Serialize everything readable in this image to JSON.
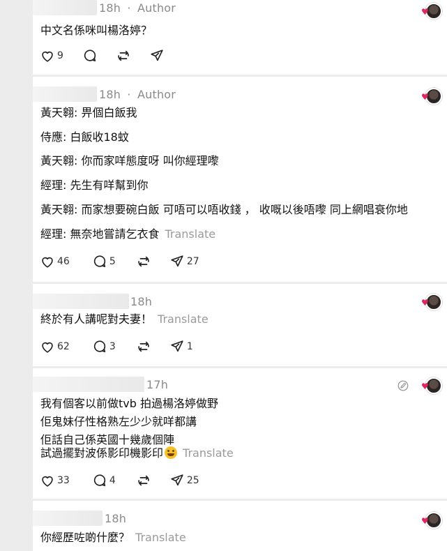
{
  "colors": {
    "background": "#ececec",
    "card": "#ffffff",
    "muted": "#8a8a8a",
    "translate": "#9a9a9a",
    "text": "#121212"
  },
  "comments": [
    {
      "time": "18h",
      "author_tag": "Author",
      "lines": [
        "中文名係咪叫楊洛婷？"
      ],
      "translate": "",
      "likes": "9",
      "replies": "",
      "reposts": "",
      "shares": ""
    },
    {
      "time": "18h",
      "author_tag": "Author",
      "lines": [
        "黃天翱: 畀個白飯我",
        "侍應: 白飯收18蚊",
        "黃天翱: 你而家咩態度呀 叫你經理嚟",
        "經理: 先生有咩幫到你",
        "黃天翱: 而家想要碗白飯 可唔可以唔收錢 ， 收嘅以後唔嚟 同上網唱衰你地",
        "經理: 無奈地嘗請乞衣食"
      ],
      "translate": "Translate",
      "likes": "46",
      "replies": "5",
      "reposts": "",
      "shares": "27"
    },
    {
      "time": "18h",
      "author_tag": "",
      "lines": [
        "終於有人講呢對夫妻！"
      ],
      "translate": "Translate",
      "likes": "62",
      "replies": "3",
      "reposts": "",
      "shares": "1"
    },
    {
      "time": "17h",
      "author_tag": "",
      "lines": [
        "我有個客以前做tvb 拍過楊洛婷做野",
        "佢鬼妹仔性格熟左少少就咩都講",
        "佢話自己係英國十幾歲個陣",
        "試過擺對波係影印機影印"
      ],
      "translate": "Translate",
      "likes": "33",
      "replies": "4",
      "reposts": "",
      "shares": "25"
    },
    {
      "time": "18h",
      "author_tag": "",
      "lines": [
        "你經歷咗啲什麼？"
      ],
      "translate": "Translate",
      "likes": "",
      "replies": "",
      "reposts": "",
      "shares": ""
    }
  ],
  "separator": "·",
  "icons": [
    "heart-icon",
    "comment-icon",
    "repost-icon",
    "share-icon",
    "edit-icon",
    "avatar"
  ]
}
